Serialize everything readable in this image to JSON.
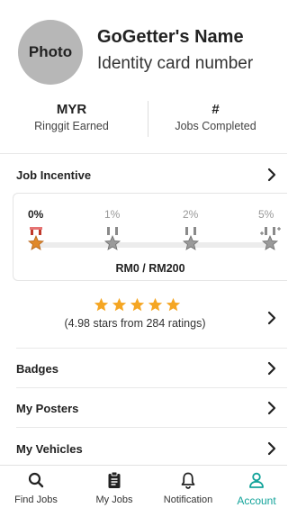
{
  "profile": {
    "avatar_text": "Photo",
    "name": "GoGetter's Name",
    "identity": "Identity card number"
  },
  "stats": {
    "earned_value": "MYR",
    "earned_label": "Ringgit Earned",
    "jobs_value": "#",
    "jobs_label": "Jobs Completed"
  },
  "job_incentive": {
    "label": "Job Incentive",
    "tiers": [
      "0%",
      "1%",
      "2%",
      "5%"
    ],
    "active_tier": 0,
    "progress_text": "RM0 / RM200"
  },
  "rating": {
    "stars": 5,
    "text": "(4.98 stars from 284 ratings)"
  },
  "menu": {
    "badges": "Badges",
    "posters": "My Posters",
    "vehicles": "My Vehicles"
  },
  "nav": {
    "find_jobs": "Find Jobs",
    "my_jobs": "My Jobs",
    "notification": "Notification",
    "account": "Account"
  },
  "colors": {
    "accent": "#12a39a",
    "star": "#f5a623",
    "medal_gold": "#e0892b",
    "medal_ribbon": "#c0392b",
    "medal_gray": "#8a8a8a"
  }
}
